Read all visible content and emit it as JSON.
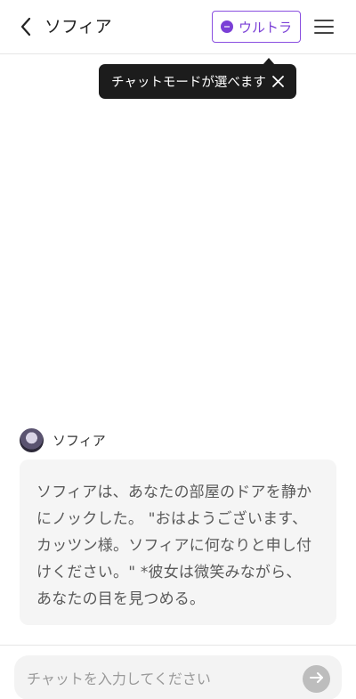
{
  "header": {
    "title": "ソフィア",
    "mode_label": "ウルトラ"
  },
  "tooltip": {
    "text": "チャットモードが選べます"
  },
  "message": {
    "sender": "ソフィア",
    "lines": [
      "ソフィアは、あなたの部屋のドアを静か",
      "にノックした。 \"おはようございます、",
      "カッツン様。ソフィアに何なりと申し付",
      "けください。\" *彼女は微笑みながら、",
      "あなたの目を見つめる。"
    ]
  },
  "input": {
    "placeholder": "チャットを入力してください",
    "value": ""
  },
  "colors": {
    "accent": "#7a3fd6",
    "tooltip_bg": "#1c1c1c",
    "bubble_bg": "#f5f5f5",
    "send_button": "#bdbdbd"
  },
  "icons": {
    "back": "chevron-left-icon",
    "mode": "chat-bubble-icon",
    "menu": "hamburger-menu-icon",
    "close": "close-icon",
    "send": "arrow-right-icon"
  }
}
